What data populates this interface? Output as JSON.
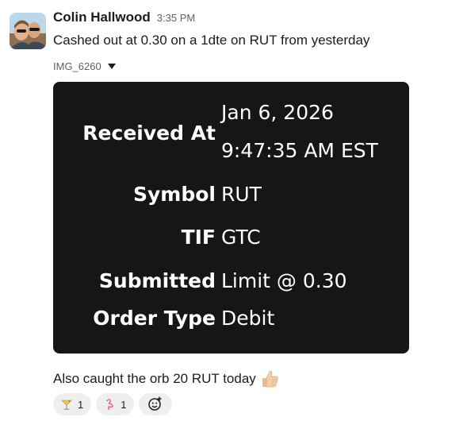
{
  "message": {
    "sender": "Colin Hallwood",
    "time": "3:35 PM",
    "text": "Cashed out at 0.30 on a 1dte on RUT from yesterday",
    "attachment_name": "IMG_6260",
    "followup_text": "Also caught the orb 20 RUT today",
    "followup_emoji": "thumbs-up-icon"
  },
  "order_card": {
    "received_label": "Received At",
    "received_date": "Jan 6, 2026",
    "received_time": "9:47:35 AM EST",
    "symbol_label": "Symbol",
    "symbol_value": "RUT",
    "tif_label": "TIF",
    "tif_value": "GTC",
    "submitted_label": "Submitted",
    "submitted_value": "Limit @ 0.30",
    "order_type_label": "Order Type",
    "order_type_value": "Debit"
  },
  "reactions": [
    {
      "emoji": "cocktail-icon",
      "count": "1"
    },
    {
      "emoji": "flamingo-icon",
      "count": "1"
    }
  ],
  "add_reaction_icon": "add-reaction-icon"
}
